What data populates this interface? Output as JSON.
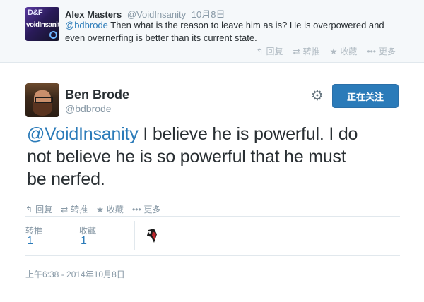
{
  "reply": {
    "avatar_lines": [
      "D&F",
      "voidInsanity"
    ],
    "name": "Alex Masters",
    "handle": "@VoidInsanity",
    "date": "10月8日",
    "mention": "@bdbrode",
    "text_line1": " Then what is the reason to leave him as is? He is overpowered and",
    "text_line2": "even overnerfing is better than its current state.",
    "actions": {
      "reply_label": "回复",
      "retweet_label": "转推",
      "favorite_label": "收藏",
      "more_label": "更多"
    }
  },
  "tweet": {
    "name": "Ben Brode",
    "handle": "@bdbrode",
    "follow_label": "正在关注",
    "mention": "@VoidInsanity",
    "text_line1": " I believe he is powerful. I do",
    "text_line2": "not believe he is so powerful that he must",
    "text_line3": "be nerfed.",
    "actions": {
      "reply_label": "回复",
      "retweet_label": "转推",
      "favorite_label": "收藏",
      "more_label": "更多"
    },
    "stats": {
      "retweets_label": "转推",
      "retweets_count": "1",
      "favorites_label": "收藏",
      "favorites_count": "1"
    },
    "timestamp": "上午6:38 - 2014年10月8日"
  },
  "colors": {
    "link": "#2b7bb9",
    "muted": "#8899a6",
    "follow_button": "#2b7bb9"
  },
  "icons": [
    "reply-icon",
    "retweet-icon",
    "favorite-star-icon",
    "more-dots-icon",
    "gear-icon"
  ]
}
